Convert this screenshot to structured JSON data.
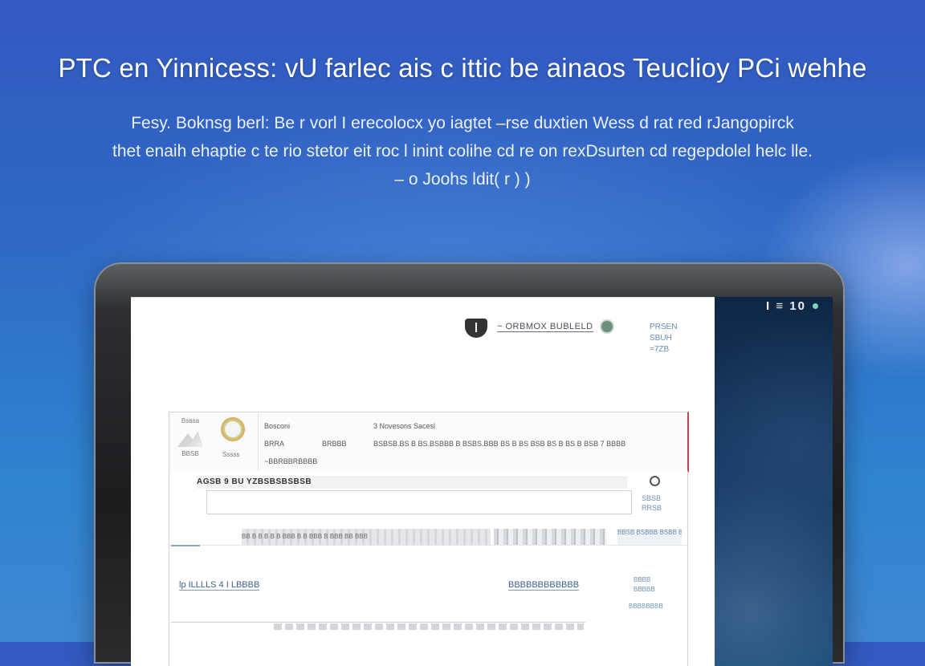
{
  "hero": {
    "title": "PTC en Yinnicess: vU farlec ais c ittic be ainaos Teuclioy PCi wehhe",
    "subtitle_lines": [
      "Fesy. Boknsg berl: Be r vorl I erecolocx yo iagtet –rse duxtien Wess d rat red rJangopirck",
      "thet enaih ehaptie c te rio stetor eit roc l inint colihe cd re on rexDsurten cd regepdolel helc lle.",
      "– o Joohs ldit( r ) )"
    ]
  },
  "device": {
    "status_text": "I ≡ 10",
    "page": {
      "header_link": "~ ORBMOX BUBLELD",
      "header_meta_1": "PRSEN",
      "header_meta_2": "SBUH",
      "header_meta_3": "=7ZB",
      "profile": {
        "thumb_label": "Bsasa",
        "thumb_caption": "BBSB",
        "avatar_label": "Sssss",
        "col1_title": "Bosconi",
        "col1_row1": "BRRA",
        "col1_row2": "~BBRBBRBBBB",
        "col2_row1": "BRBBB",
        "col3_title": "3 Novesons Sacesl",
        "col3_row1": "BSBSB.BS B BS.BSBBB B BSBS.BBB BS B BS BSB BS B BS B     BSB 7 BBBB"
      },
      "section_heading": "AGSB 9 BU  YZBSBSBSBSB",
      "side_note_1": "SBSB",
      "side_note_2": "RRSB",
      "strip_text": "BB B B B B B BBB B B BBB B BBB BB BBB",
      "strip_side": "BBSB BSBBB BSBB BSBBB",
      "link_left": "lp ILLLLS 4 I  LBBBB",
      "link_right": "BBBBBBBBBBBB",
      "link_side_1": "BBBB",
      "link_side_2": "BBBBB",
      "foot_side": "BBBBBBBB"
    }
  }
}
